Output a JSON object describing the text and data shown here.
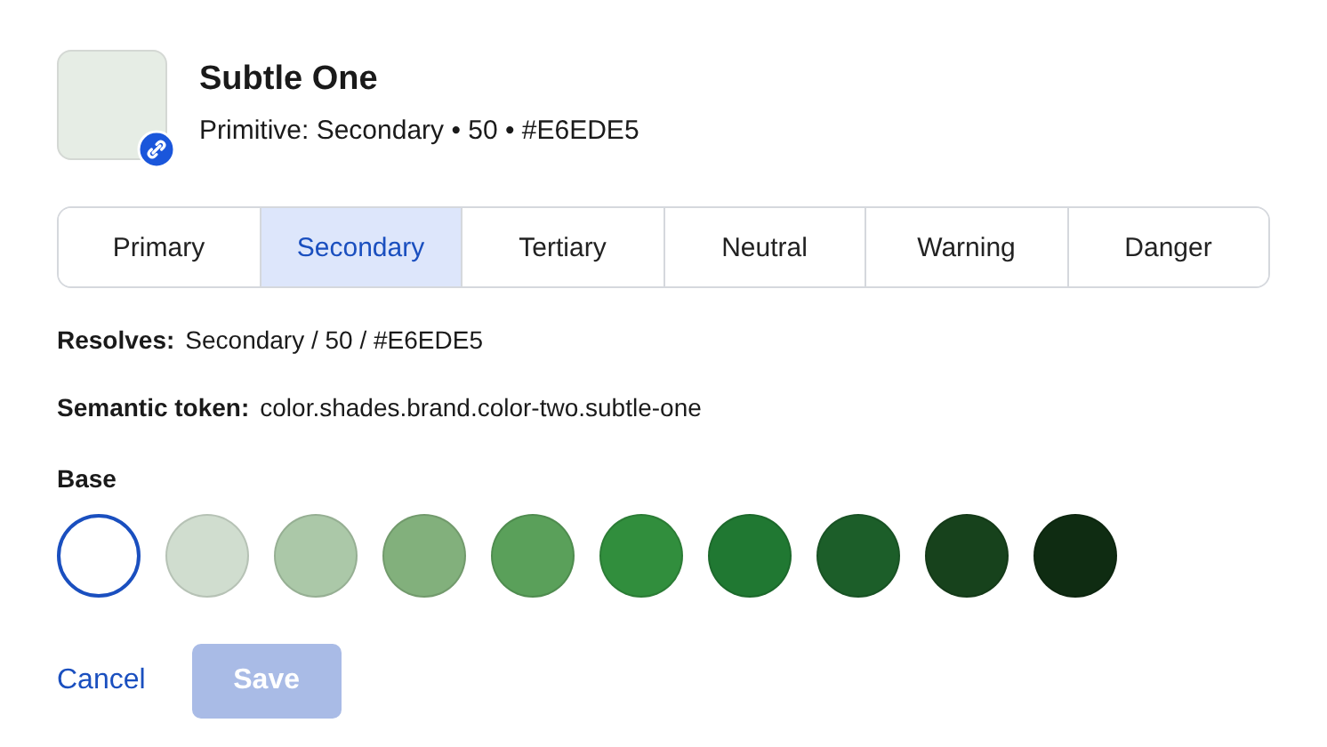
{
  "header": {
    "title": "Subtle One",
    "subtitle": "Primitive: Secondary • 50 • #E6EDE5"
  },
  "tabs": [
    {
      "label": "Primary",
      "selected": false
    },
    {
      "label": "Secondary",
      "selected": true
    },
    {
      "label": "Tertiary",
      "selected": false
    },
    {
      "label": "Neutral",
      "selected": false
    },
    {
      "label": "Warning",
      "selected": false
    },
    {
      "label": "Danger",
      "selected": false
    }
  ],
  "details": [
    {
      "label": "Resolves:",
      "value": "Secondary / 50 / #E6EDE5"
    },
    {
      "label": "Semantic token:",
      "value": "color.shades.brand.color-two.subtle-one"
    }
  ],
  "base": {
    "label": "Base",
    "swatches": [
      {
        "color": "#ffffff",
        "selected": true
      },
      {
        "color": "#d0ddcf",
        "selected": false
      },
      {
        "color": "#abc8a8",
        "selected": false
      },
      {
        "color": "#82b07c",
        "selected": false
      },
      {
        "color": "#5aa05a",
        "selected": false
      },
      {
        "color": "#318e3d",
        "selected": false
      },
      {
        "color": "#207832",
        "selected": false
      },
      {
        "color": "#1c5e29",
        "selected": false
      },
      {
        "color": "#17421c",
        "selected": false
      },
      {
        "color": "#0f2c12",
        "selected": false
      }
    ]
  },
  "actions": {
    "cancel": "Cancel",
    "save": "Save",
    "save_disabled": true
  }
}
